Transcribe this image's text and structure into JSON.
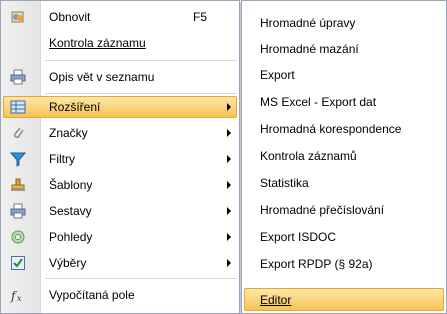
{
  "main_menu": {
    "items": [
      {
        "label": "Obnovit",
        "shortcut": "F5"
      },
      {
        "label": "Kontrola záznamu"
      },
      {
        "label": "Opis vět v seznamu"
      },
      {
        "label": "Rozšíření"
      },
      {
        "label": "Značky"
      },
      {
        "label": "Filtry"
      },
      {
        "label": "Šablony"
      },
      {
        "label": "Sestavy"
      },
      {
        "label": "Pohledy"
      },
      {
        "label": "Výběry"
      },
      {
        "label": "Vypočítaná pole"
      }
    ]
  },
  "sub_menu": {
    "items": [
      {
        "label": "Hromadné úpravy"
      },
      {
        "label": "Hromadné mazání"
      },
      {
        "label": "Export"
      },
      {
        "label": "MS Excel - Export dat"
      },
      {
        "label": "Hromadná korespondence"
      },
      {
        "label": "Kontrola záznamů"
      },
      {
        "label": "Statistika"
      },
      {
        "label": "Hromadné přečíslování"
      },
      {
        "label": "Export ISDOC"
      },
      {
        "label": "Export RPDP (§ 92a)"
      },
      {
        "label": "Editor"
      }
    ]
  },
  "colors": {
    "highlight_top": "#fde7a6",
    "highlight_bottom": "#f8c255",
    "menu_border": "#97a5bf"
  }
}
